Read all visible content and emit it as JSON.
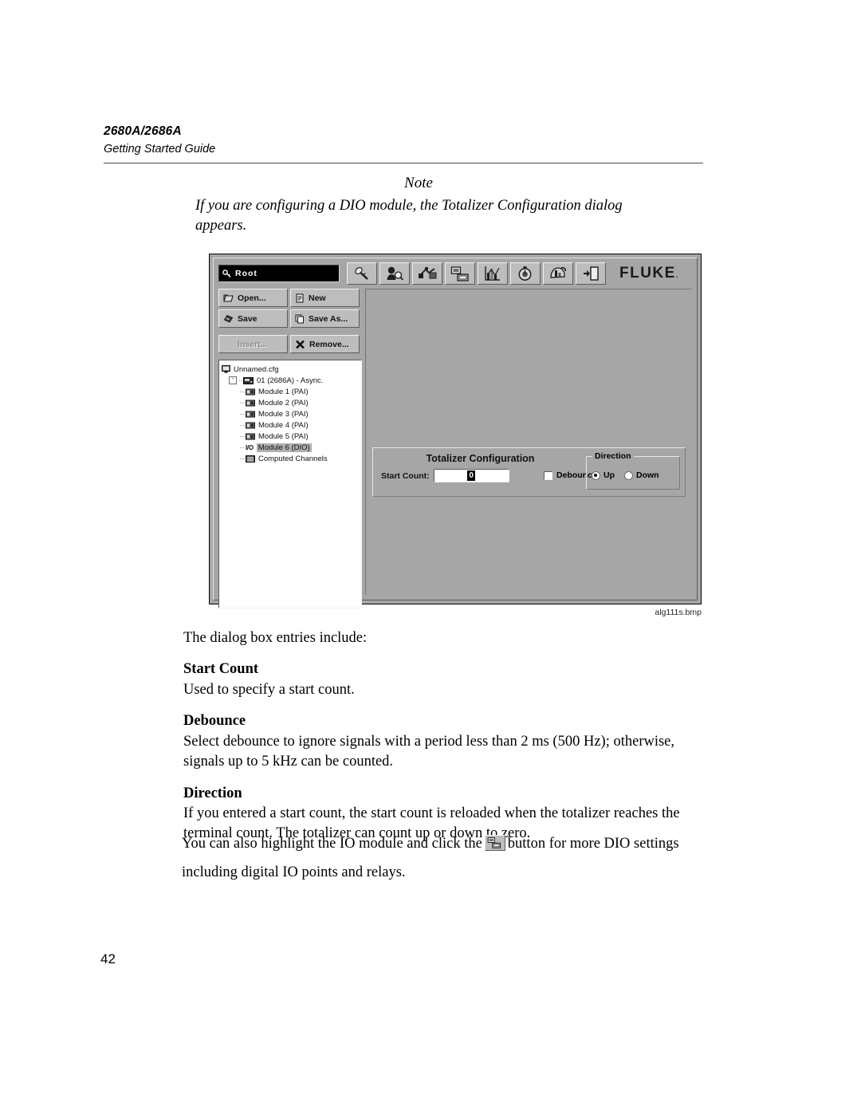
{
  "header": {
    "model": "2680A/2686A",
    "subtitle": "Getting Started Guide"
  },
  "note": {
    "title": "Note",
    "body": "If you are configuring a DIO module, the Totalizer Configuration dialog appears."
  },
  "screenshot": {
    "caption": "alg111s.bmp",
    "toolbar": {
      "root_label": "Root",
      "brand": "FLUKE",
      "brand_mark": ".",
      "icons": [
        "probe-icon",
        "person-inspector-icon",
        "wiring-tool-icon",
        "computer-icon",
        "chart-icon",
        "timer-icon",
        "print-data-icon",
        "exit-door-icon"
      ]
    },
    "commands": [
      {
        "label": "Open...",
        "icon": "folder-open-icon",
        "disabled": false
      },
      {
        "label": "New",
        "icon": "new-document-icon",
        "disabled": false
      },
      {
        "label": "Save",
        "icon": "floppy-disk-icon",
        "disabled": false
      },
      {
        "label": "Save As...",
        "icon": "save-as-icon",
        "disabled": false
      },
      {
        "label": "Insert...",
        "icon": "insert-icon",
        "disabled": true
      },
      {
        "label": "Remove...",
        "icon": "x-mark-icon",
        "disabled": false
      }
    ],
    "tree": [
      {
        "label": "Unnamed.cfg",
        "level": 0,
        "icon": "computer-icon",
        "selected": false,
        "expander": ""
      },
      {
        "label": "01 (2686A) - Async.",
        "level": 1,
        "icon": "instrument-icon",
        "selected": false,
        "expander": "-"
      },
      {
        "label": "Module 1 (PAI)",
        "level": 2,
        "icon": "module-icon",
        "selected": false,
        "expander": ""
      },
      {
        "label": "Module 2 (PAI)",
        "level": 2,
        "icon": "module-icon",
        "selected": false,
        "expander": ""
      },
      {
        "label": "Module 3 (PAI)",
        "level": 2,
        "icon": "module-icon",
        "selected": false,
        "expander": ""
      },
      {
        "label": "Module 4 (PAI)",
        "level": 2,
        "icon": "module-icon",
        "selected": false,
        "expander": ""
      },
      {
        "label": "Module 5 (PAI)",
        "level": 2,
        "icon": "module-icon",
        "selected": false,
        "expander": ""
      },
      {
        "label": "Module 6 (DIO)",
        "level": 2,
        "icon": "io-module-icon",
        "selected": true,
        "expander": ""
      },
      {
        "label": "Computed Channels",
        "level": 2,
        "icon": "computed-channels-icon",
        "selected": false,
        "expander": ""
      }
    ],
    "dialog": {
      "title": "Totalizer Configuration",
      "start_count_label": "Start Count:",
      "start_count_value": "0",
      "debounce_label": "Debounce",
      "debounce_checked": false,
      "direction_legend": "Direction",
      "direction_options": [
        {
          "label": "Up",
          "selected": true
        },
        {
          "label": "Down",
          "selected": false
        }
      ]
    }
  },
  "body": {
    "intro": "The dialog box entries include:",
    "sections": [
      {
        "heading": "Start Count",
        "text": "Used to specify a start count."
      },
      {
        "heading": "Debounce",
        "text": "Select debounce to ignore signals with a period less than 2 ms (500 Hz); otherwise, signals up to 5 kHz can be counted."
      },
      {
        "heading": "Direction",
        "text": "If you entered a start count, the start count is reloaded when the totalizer reaches the terminal count. The totalizer can count up or down to zero."
      }
    ],
    "tail_before_icon": "You can also highlight the IO module and click the",
    "tail_after_icon": "button for more DIO settings including digital IO points and relays."
  },
  "page_number": "42"
}
